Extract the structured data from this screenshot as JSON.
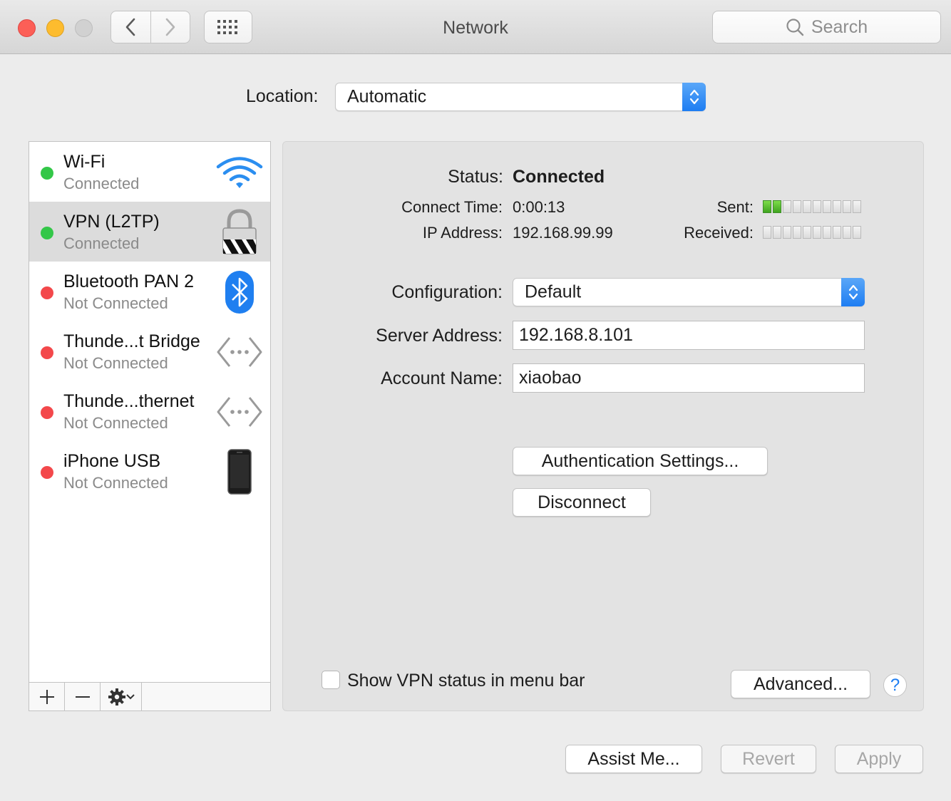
{
  "window": {
    "title": "Network"
  },
  "search": {
    "placeholder": "Search"
  },
  "location": {
    "label": "Location:",
    "value": "Automatic"
  },
  "services": [
    {
      "name": "Wi-Fi",
      "status": "Connected",
      "status_color": "#33c748",
      "icon": "wifi-icon",
      "selected": false
    },
    {
      "name": "VPN (L2TP)",
      "status": "Connected",
      "status_color": "#33c748",
      "icon": "vpn-lock-icon",
      "selected": true
    },
    {
      "name": "Bluetooth PAN 2",
      "status": "Not Connected",
      "status_color": "#f3484b",
      "icon": "bluetooth-icon",
      "selected": false
    },
    {
      "name": "Thunde...t Bridge",
      "status": "Not Connected",
      "status_color": "#f3484b",
      "icon": "ethernet-icon",
      "selected": false
    },
    {
      "name": "Thunde...thernet",
      "status": "Not Connected",
      "status_color": "#f3484b",
      "icon": "ethernet-icon",
      "selected": false
    },
    {
      "name": "iPhone USB",
      "status": "Not Connected",
      "status_color": "#f3484b",
      "icon": "iphone-icon",
      "selected": false
    }
  ],
  "detail": {
    "status_label": "Status:",
    "status_value": "Connected",
    "connect_time_label": "Connect Time:",
    "connect_time_value": "0:00:13",
    "ip_label": "IP Address:",
    "ip_value": "192.168.99.99",
    "sent_label": "Sent:",
    "sent_level": 0.2,
    "received_label": "Received:",
    "received_level": 0,
    "configuration_label": "Configuration:",
    "configuration_value": "Default",
    "server_label": "Server Address:",
    "server_value": "192.168.8.101",
    "account_label": "Account Name:",
    "account_value": "xiaobao",
    "auth_button": "Authentication Settings...",
    "disconnect_button": "Disconnect",
    "show_vpn_label": "Show VPN status in menu bar",
    "show_vpn_checked": false,
    "advanced_button": "Advanced...",
    "help_symbol": "?"
  },
  "footer": {
    "assist_button": "Assist Me...",
    "revert_button": "Revert",
    "apply_button": "Apply"
  },
  "colors": {
    "accent": "#1e7df2",
    "connected": "#33c748",
    "disconnected": "#f3484b"
  }
}
